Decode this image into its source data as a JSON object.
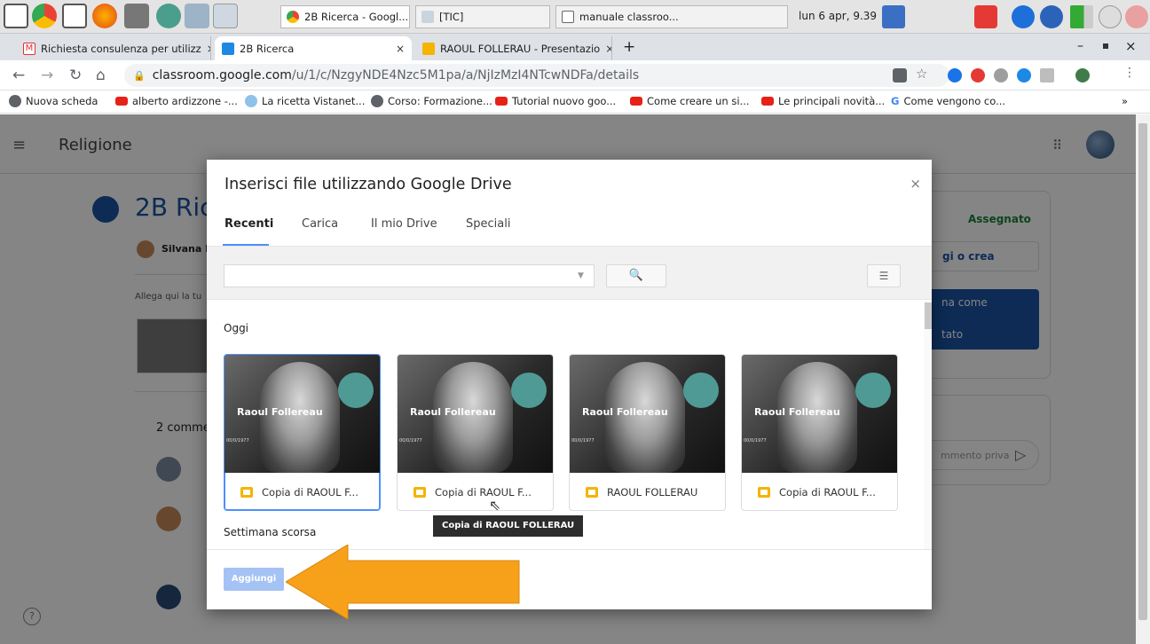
{
  "taskbar": {
    "tasks": [
      {
        "label": "2B Ricerca - Googl..."
      },
      {
        "label": "[TIC]"
      },
      {
        "label": "manuale classroo..."
      }
    ],
    "clock": "lun 6 apr, 9.39"
  },
  "browser": {
    "tabs": [
      {
        "label": "Richiesta consulenza per utilizz"
      },
      {
        "label": "2B Ricerca"
      },
      {
        "label": "RAOUL FOLLERAU - Presentazio"
      }
    ],
    "new_tab": "+",
    "address": {
      "domain": "classroom.google.com",
      "path": "/u/1/c/NzgyNDE4Nzc5M1pa/a/NjIzMzI4NTcwNDFa/details"
    },
    "bookmarks": [
      "Nuova scheda",
      "alberto ardizzone -...",
      "La ricetta Vistanet...",
      "Corso: Formazione...",
      "Tutorial nuovo goo...",
      "Come creare un si...",
      "Le principali novità...",
      "Come vengono co..."
    ],
    "bookmarks_more": "»"
  },
  "page": {
    "class_name": "Religione",
    "assignment_title": "2B Ric",
    "teacher": "Silvana F",
    "attach_hint": "Allega qui la tu",
    "comments_title": "2 comme",
    "status": "Assegnato",
    "add_or_create": "gi o crea",
    "mark_done_1": "na come",
    "mark_done_2": "tato",
    "private_comment": "mmento priva",
    "help": "?"
  },
  "dialog": {
    "title": "Inserisci file utilizzando Google Drive",
    "close": "×",
    "tabs": [
      "Recenti",
      "Carica",
      "Il mio Drive",
      "Speciali"
    ],
    "search_placeholder": "",
    "sections": {
      "today": "Oggi",
      "last_week": "Settimana scorsa"
    },
    "files": [
      {
        "name": "Copia di RAOUL F...",
        "thumb_title": "Raoul Follereau",
        "thumb_sub": "00/0/1977"
      },
      {
        "name": "Copia di RAOUL F...",
        "thumb_title": "Raoul Follereau",
        "thumb_sub": "00/0/1977"
      },
      {
        "name": "RAOUL FOLLERAU",
        "thumb_title": "Raoul Follereau",
        "thumb_sub": "00/0/1977"
      },
      {
        "name": "Copia di RAOUL F...",
        "thumb_title": "Raoul Follereau",
        "thumb_sub": "00/0/1977"
      }
    ],
    "tooltip": "Copia di RAOUL FOLLERAU",
    "add_button": "Aggiungi"
  },
  "colors": {
    "accent_blue": "#4d90fe",
    "classroom_blue": "#1a53a4",
    "status_green": "#188038",
    "arrow_orange": "#f7a11a",
    "slides_yellow": "#f4b400"
  }
}
